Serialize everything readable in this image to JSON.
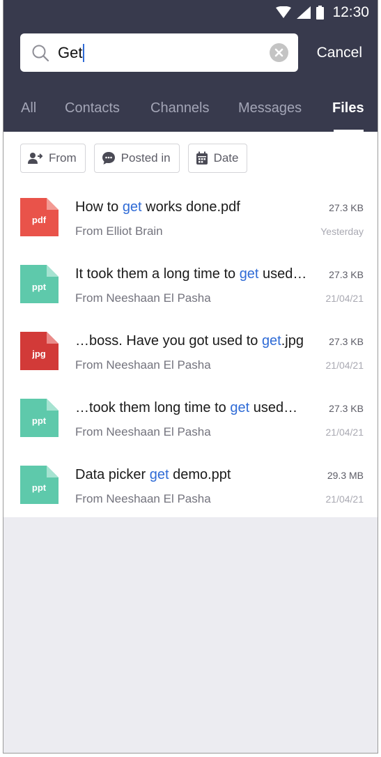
{
  "status_bar": {
    "time": "12:30"
  },
  "search": {
    "query": "Get",
    "cancel_label": "Cancel"
  },
  "tabs": [
    {
      "label": "All",
      "active": false
    },
    {
      "label": "Contacts",
      "active": false
    },
    {
      "label": "Channels",
      "active": false
    },
    {
      "label": "Messages",
      "active": false
    },
    {
      "label": "Files",
      "active": true
    }
  ],
  "filters": [
    {
      "label": "From",
      "icon": "person-arrow-icon"
    },
    {
      "label": "Posted in",
      "icon": "chat-bubble-icon"
    },
    {
      "label": "Date",
      "icon": "calendar-icon"
    }
  ],
  "colors": {
    "header_bg": "#383a4d",
    "highlight": "#2f6bd6",
    "pdf": "#e9534a",
    "ppt": "#5ec9ab",
    "jpg": "#d23a38",
    "empty_area": "#ececf1"
  },
  "files": [
    {
      "type": "pdf",
      "title_before": "How to ",
      "title_match": "get",
      "title_after": " works done.pdf",
      "from": "From Elliot Brain",
      "size": "27.3 KB",
      "date": "Yesterday"
    },
    {
      "type": "ppt",
      "title_before": "It took them a long time to ",
      "title_match": "get",
      "title_after": " used…",
      "from": "From Neeshaan El Pasha",
      "size": "27.3 KB",
      "date": "21/04/21"
    },
    {
      "type": "jpg",
      "title_before": "…boss. Have you got used to ",
      "title_match": "get",
      "title_after": ".jpg",
      "from": "From Neeshaan El Pasha",
      "size": "27.3 KB",
      "date": "21/04/21"
    },
    {
      "type": "ppt",
      "title_before": "…took them long time to ",
      "title_match": "get",
      "title_after": " used…",
      "from": "From Neeshaan El Pasha",
      "size": "27.3 KB",
      "date": "21/04/21"
    },
    {
      "type": "ppt",
      "title_before": "Data picker ",
      "title_match": "get",
      "title_after": " demo.ppt",
      "from": "From Neeshaan El Pasha",
      "size": "29.3 MB",
      "date": "21/04/21"
    }
  ]
}
